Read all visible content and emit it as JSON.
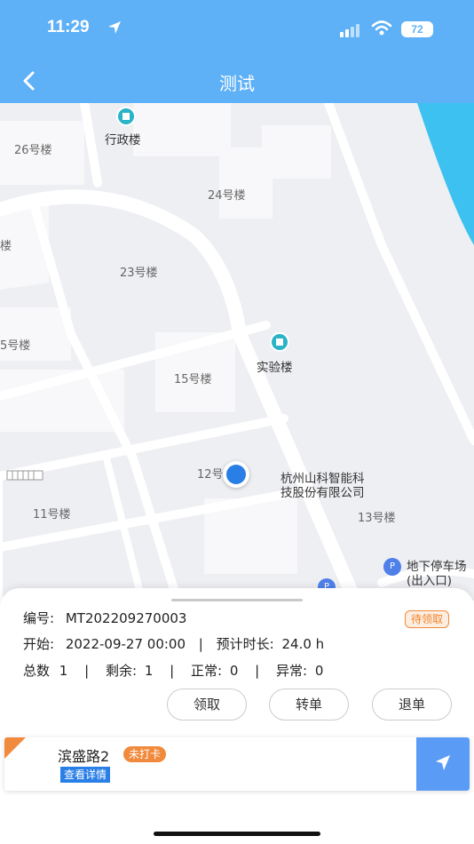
{
  "status_bar": {
    "time": "11:29",
    "battery": "72"
  },
  "header": {
    "title": "测试"
  },
  "map": {
    "labels": {
      "building_26": "26号楼",
      "admin": "行政楼",
      "building_24": "24号楼",
      "building_23": "23号楼",
      "lou_left": "楼",
      "building_5_partial": "5号楼",
      "building_15": "15号楼",
      "lab": "实验楼",
      "building_12": "12号",
      "company_line1": "杭州山科智能科",
      "company_line2": "技股份有限公司",
      "building_11": "11号楼",
      "building_13": "13号楼",
      "parking_line1": "地下停车场",
      "parking_line2": "(出入口)"
    }
  },
  "task": {
    "id_label": "编号:",
    "id_value": "MT202209270003",
    "status": "待领取",
    "start_label": "开始:",
    "start_value": "2022-09-27 00:00",
    "duration_label": "预计时长:",
    "duration_value": "24.0 h",
    "total_label": "总数",
    "total_value": "1",
    "remaining_label": "剩余:",
    "remaining_value": "1",
    "normal_label": "正常:",
    "normal_value": "0",
    "abnormal_label": "异常:",
    "abnormal_value": "0",
    "separator": "|"
  },
  "actions": {
    "claim": "领取",
    "transfer": "转单",
    "return": "退单"
  },
  "point_card": {
    "name": "滨盛路2",
    "badge": "未打卡",
    "detail_link": "查看详情"
  },
  "colors": {
    "header": "#5eb1f6",
    "accent_orange": "#f08a3c",
    "accent_blue": "#2a7fe6",
    "nav_button": "#5a9cf5"
  }
}
